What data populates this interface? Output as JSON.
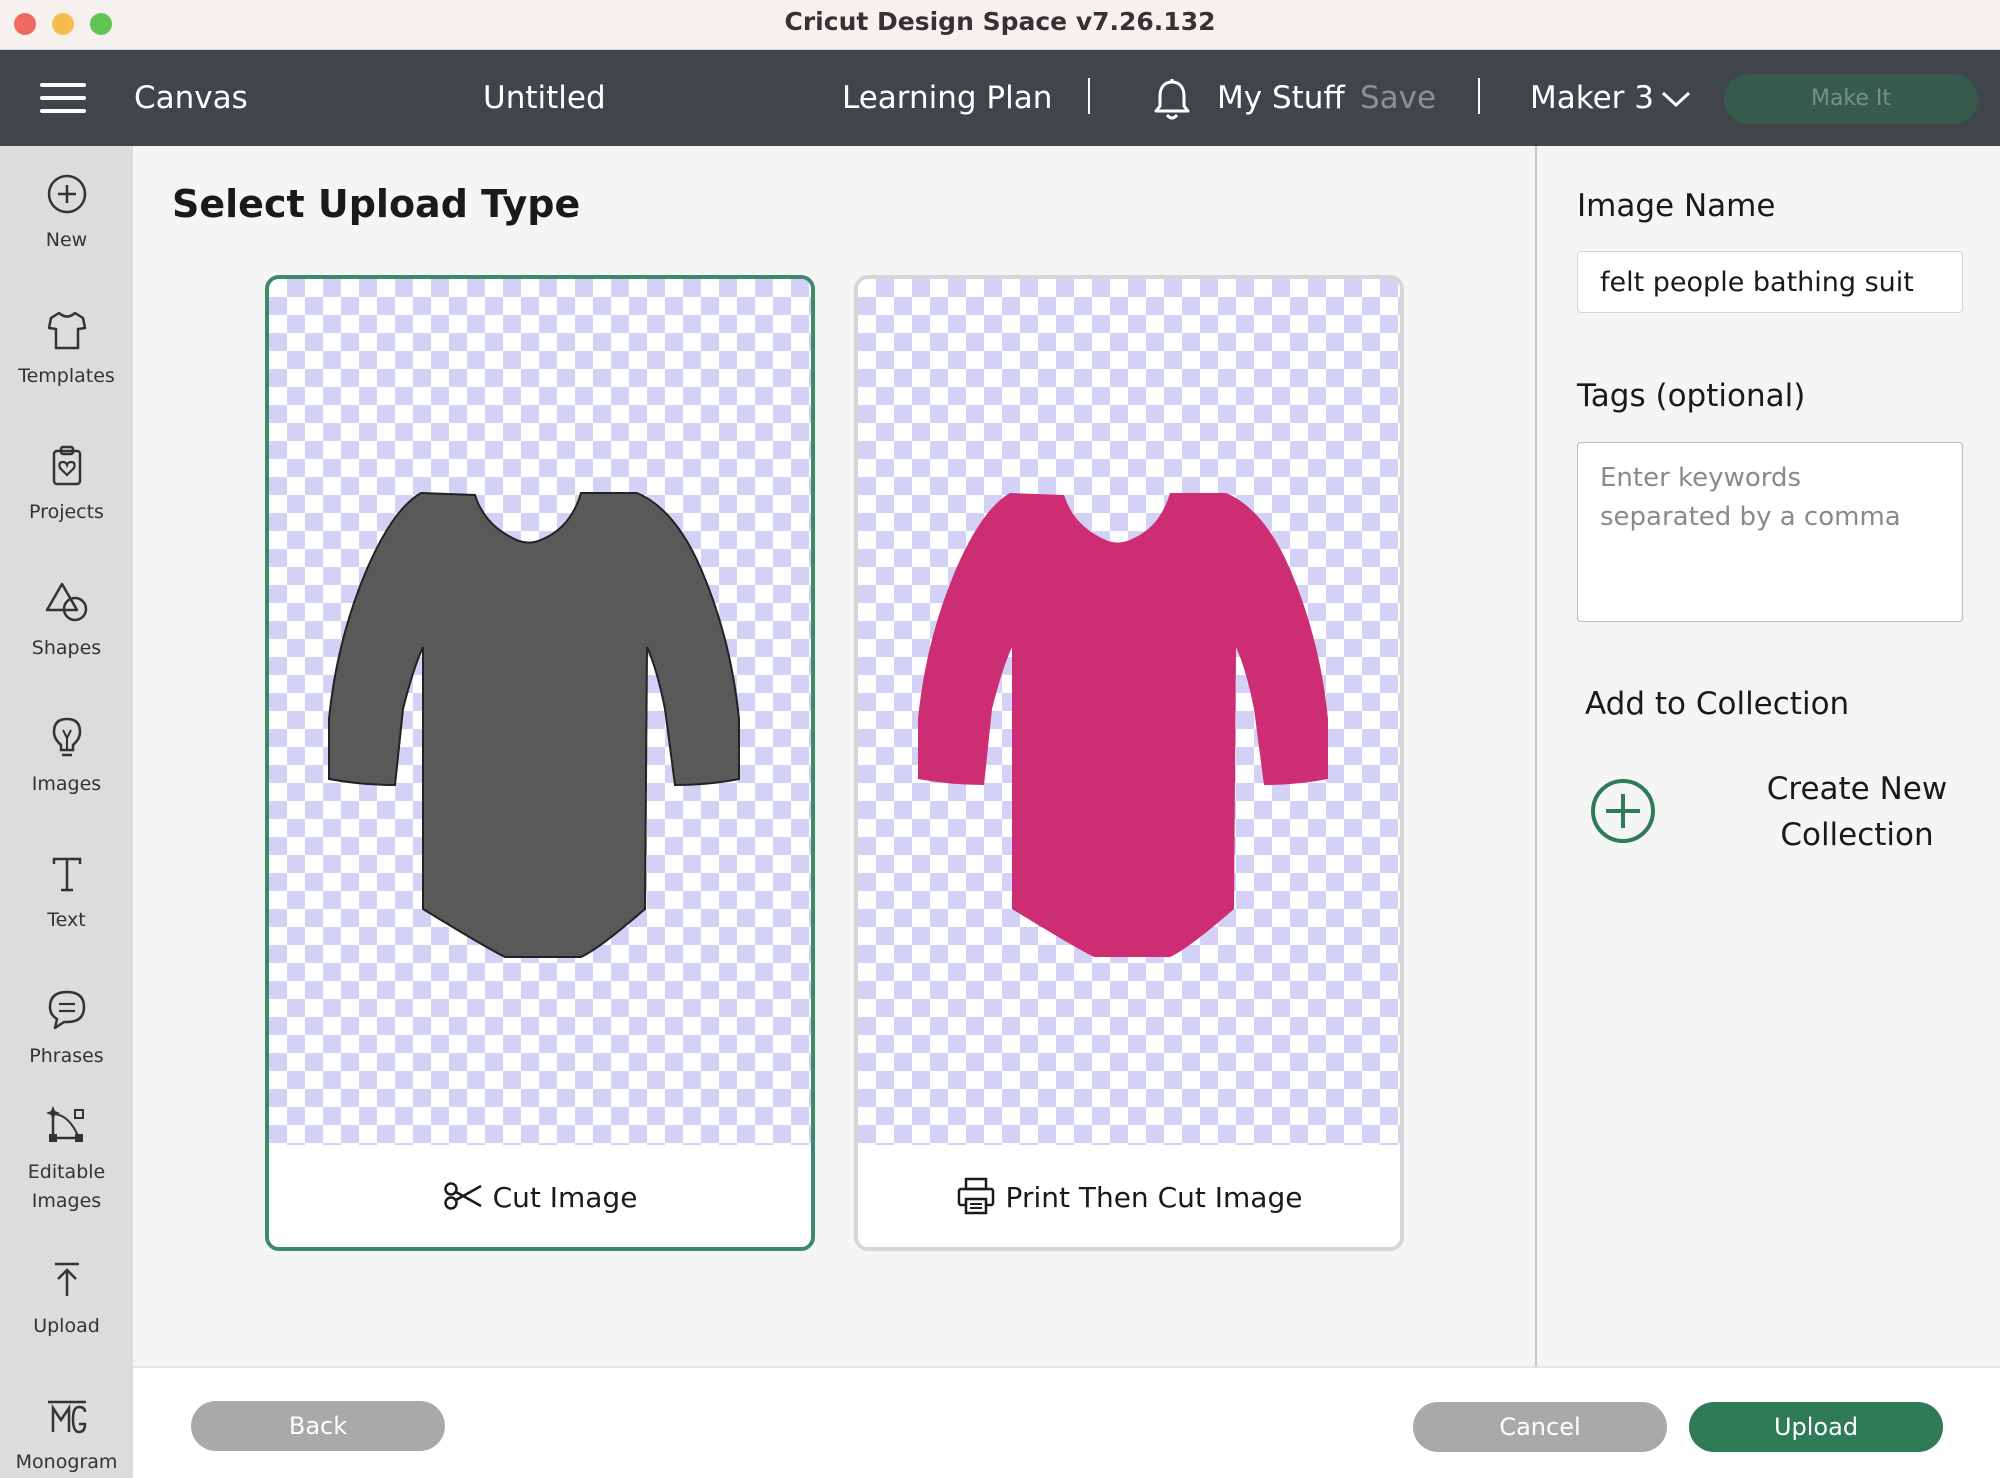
{
  "window": {
    "title": "Cricut Design Space  v7.26.132"
  },
  "topnav": {
    "canvas_label": "Canvas",
    "project_name": "Untitled",
    "learning_plan": "Learning Plan",
    "separator": "|",
    "my_stuff": "My Stuff",
    "save": "Save",
    "machine": "Maker 3",
    "make_it": "Make It"
  },
  "sidebar": {
    "items": [
      {
        "label": "New",
        "icon": "plus-circle-icon"
      },
      {
        "label": "Templates",
        "icon": "tshirt-icon"
      },
      {
        "label": "Projects",
        "icon": "clipboard-heart-icon"
      },
      {
        "label": "Shapes",
        "icon": "shapes-icon"
      },
      {
        "label": "Images",
        "icon": "lightbulb-icon"
      },
      {
        "label": "Text",
        "icon": "text-icon"
      },
      {
        "label": "Phrases",
        "icon": "speech-bubble-icon"
      },
      {
        "label": "Editable\nImages",
        "icon": "vector-edit-icon"
      },
      {
        "label": "Upload",
        "icon": "upload-arrow-icon"
      },
      {
        "label": "Monogram",
        "icon": "monogram-icon"
      }
    ]
  },
  "main": {
    "title": "Select Upload Type",
    "cards": [
      {
        "label": "Cut Image",
        "icon": "scissors-icon",
        "selected": true,
        "garment_color": "#595959"
      },
      {
        "label": "Print Then Cut Image",
        "icon": "printer-icon",
        "selected": false,
        "garment_color": "#cd2d72"
      }
    ]
  },
  "right_panel": {
    "image_name_label": "Image Name",
    "image_name_value": "felt people bathing suit",
    "tags_label": "Tags (optional)",
    "tags_placeholder": "Enter keywords separated by a comma",
    "add_collection_label": "Add to Collection",
    "create_new_collection": "Create New Collection"
  },
  "bottom": {
    "back": "Back",
    "cancel": "Cancel",
    "upload": "Upload"
  },
  "colors": {
    "accent_green": "#2f7a57",
    "nav_bg": "#40454a",
    "selected_border": "#3b8b6a"
  }
}
